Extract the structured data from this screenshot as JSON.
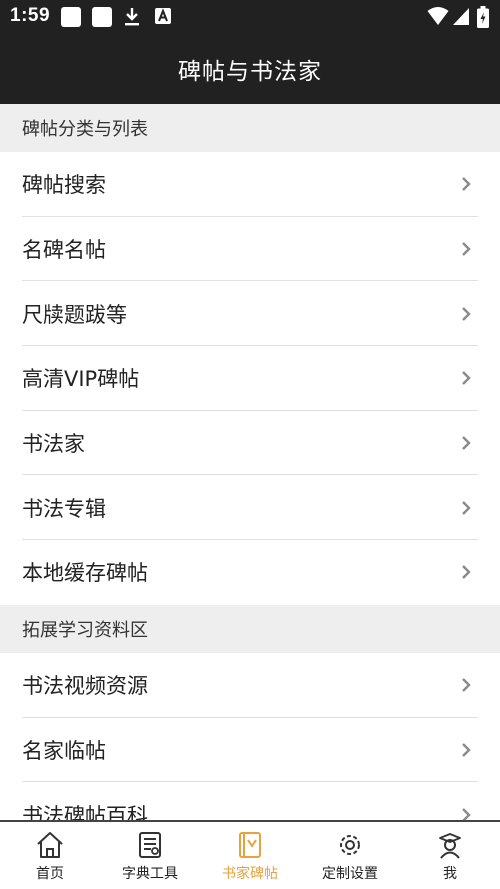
{
  "status_bar": {
    "time": "1:59",
    "left_icons": [
      "square-notification-icon",
      "square-notification-icon",
      "download-icon",
      "accessibility-a-icon"
    ],
    "right_icons": [
      "wifi-icon",
      "signal-icon",
      "battery-charging-icon"
    ]
  },
  "app_bar": {
    "title": "碑帖与书法家"
  },
  "sections": [
    {
      "header": "碑帖分类与列表",
      "items": [
        {
          "label": "碑帖搜索"
        },
        {
          "label": "名碑名帖"
        },
        {
          "label": "尺牍题跋等"
        },
        {
          "label": "高清VIP碑帖"
        },
        {
          "label": "书法家"
        },
        {
          "label": "书法专辑"
        },
        {
          "label": "本地缓存碑帖"
        }
      ]
    },
    {
      "header": "拓展学习资料区",
      "items": [
        {
          "label": "书法视频资源"
        },
        {
          "label": "名家临帖"
        },
        {
          "label": "书法碑帖百科"
        }
      ]
    }
  ],
  "bottom_nav": [
    {
      "label": "首页",
      "icon": "home-icon",
      "active": false
    },
    {
      "label": "字典工具",
      "icon": "dictionary-icon",
      "active": false
    },
    {
      "label": "书家碑帖",
      "icon": "book-icon",
      "active": true
    },
    {
      "label": "定制设置",
      "icon": "settings-icon",
      "active": false
    },
    {
      "label": "我",
      "icon": "profile-icon",
      "active": false
    }
  ],
  "colors": {
    "bar": "#212121",
    "accent": "#e6a23c",
    "section_bg": "#eeeeee",
    "divider": "#e0e0e0"
  }
}
